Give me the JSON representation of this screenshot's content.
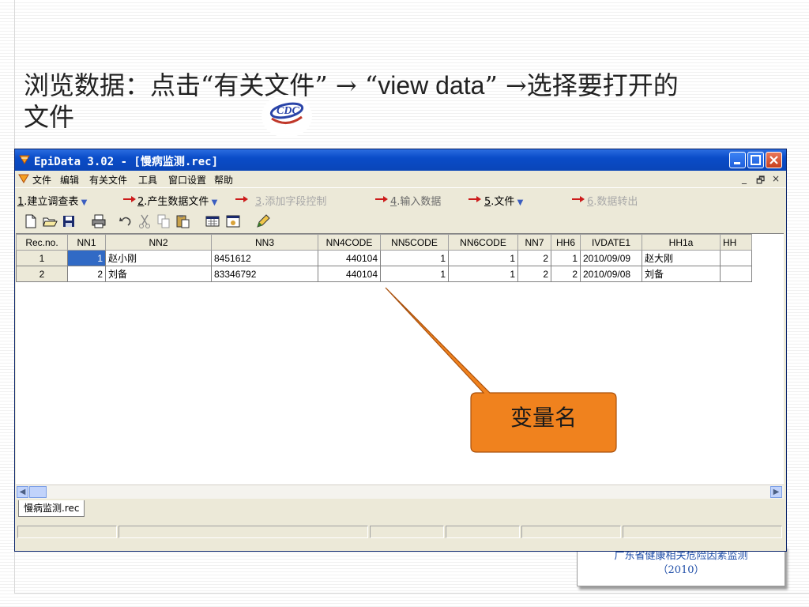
{
  "slide": {
    "title_line1_a": "浏览数据：点击“有关文件”",
    "title_arrow1": " → “",
    "title_latin": "view data",
    "title_line1_b": "” →选择要打开的",
    "title_line2": "文件",
    "footer_line1": "广东省健康相关危险因素监测",
    "footer_line2": "（2010）",
    "logo_icon": "cdc-logo"
  },
  "window": {
    "title": "EpiData 3.02 - [慢病监测.rec]",
    "menu": [
      "文件",
      "编辑",
      "有关文件",
      "工具",
      "窗口设置",
      "帮助"
    ],
    "mdi_controls": [
      "_",
      "🗗",
      "×"
    ],
    "steps": [
      {
        "num": "1",
        "label": ".建立调查表",
        "dropdown": true,
        "enabled": true
      },
      {
        "num": "2",
        "label": ".产生数据文件",
        "dropdown": true,
        "enabled": true
      },
      {
        "num": "3",
        "label": ".添加字段控制",
        "dropdown": false,
        "enabled": false
      },
      {
        "num": "4",
        "label": ".输入数据",
        "dropdown": false,
        "enabled": true
      },
      {
        "num": "5",
        "label": ".文件",
        "dropdown": true,
        "enabled": true
      },
      {
        "num": "6",
        "label": ".数据转出",
        "dropdown": false,
        "enabled": false
      }
    ],
    "toolbar_icons": [
      "new-file-icon",
      "open-folder-icon",
      "save-icon",
      "print-icon",
      "undo-icon",
      "cut-icon",
      "copy-icon",
      "paste-icon",
      "calculator-icon",
      "window-icon",
      "pencil-icon"
    ],
    "grid": {
      "columns": [
        "Rec.no.",
        "NN1",
        "NN2",
        "NN3",
        "NN4CODE",
        "NN5CODE",
        "NN6CODE",
        "NN7",
        "HH6",
        "IVDATE1",
        "HH1a",
        "HH"
      ],
      "rows": [
        [
          "1",
          "1",
          "赵小刚",
          "8451612",
          "440104",
          "1",
          "1",
          "2",
          "1",
          "2010/09/09",
          "赵大刚",
          ""
        ],
        [
          "2",
          "2",
          "刘备",
          "83346792",
          "440104",
          "1",
          "1",
          "2",
          "2",
          "2010/09/08",
          "刘备",
          ""
        ]
      ]
    },
    "doc_tab": "慢病监测.rec",
    "callout_label": "变量名",
    "colors": {
      "titlebar": "#0a4cc8",
      "selection": "#316ac5",
      "callout": "#f0821e"
    }
  }
}
